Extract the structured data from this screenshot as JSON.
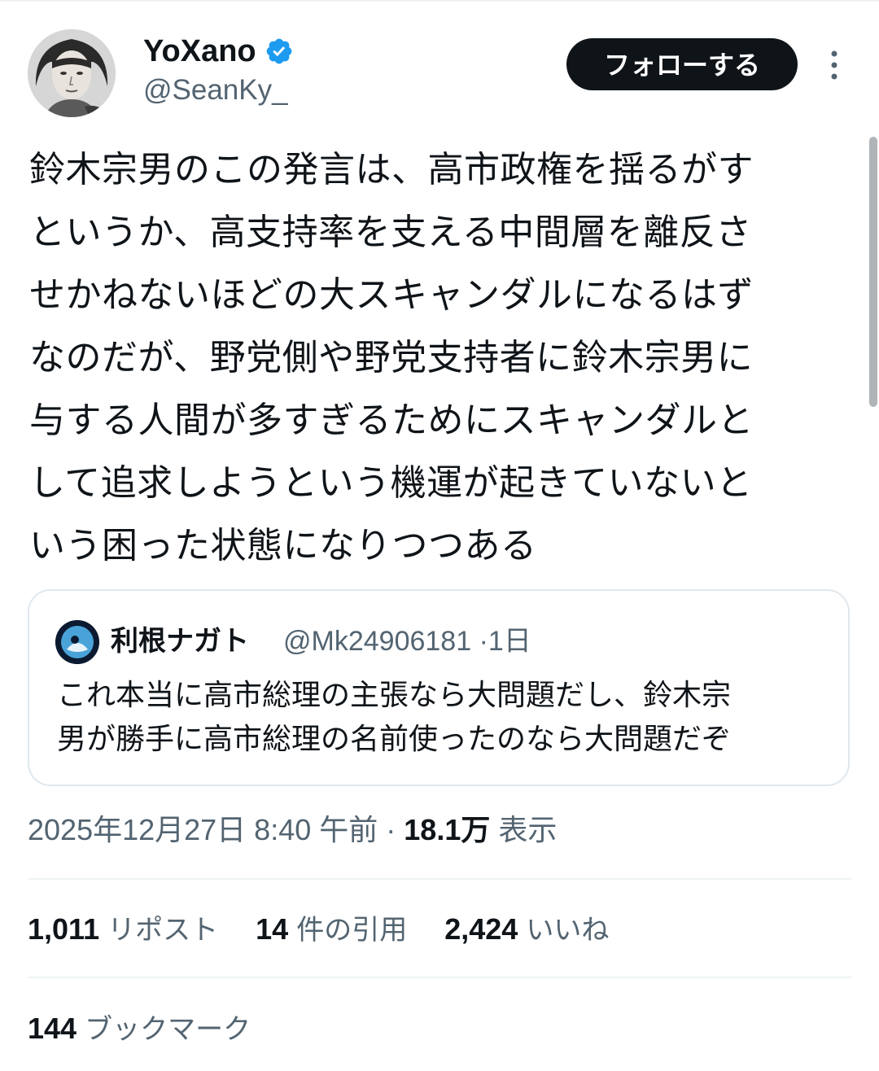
{
  "author": {
    "display_name": "YoXano",
    "handle": "@SeanKy_",
    "verified": true,
    "avatar_icon": "portrait-avatar"
  },
  "follow_button": {
    "label": "フォローする"
  },
  "more_icon": "more-vertical-icon",
  "tweet": {
    "lines": [
      "鈴木宗男のこの発言は、高市政権を揺るがす",
      "というか、高支持率を支える中間層を離反さ",
      "せかねないほどの大スキャンダルになるはず",
      "なのだが、野党側や野党支持者に鈴木宗男に",
      "与する人間が多すぎるためにスキャンダルと",
      "して追求しようという機運が起きていないと",
      "いう困った状態になりつつある"
    ]
  },
  "quote": {
    "display_name": "利根ナガト",
    "handle": "@Mk24906181",
    "separator": "·",
    "time": "1日",
    "lines": [
      "これ本当に高市総理の主張なら大問題だし、鈴木宗",
      "男が勝手に高市総理の名前使ったのなら大問題だぞ"
    ]
  },
  "meta": {
    "timestamp": "2025年12月27日 8:40 午前",
    "separator": "·",
    "views_count": "18.1万",
    "views_label": "表示"
  },
  "stats": {
    "reposts_count": "1,011",
    "reposts_label": "リポスト",
    "quotes_count": "14",
    "quotes_label": "件の引用",
    "likes_count": "2,424",
    "likes_label": "いいね",
    "bookmarks_count": "144",
    "bookmarks_label": "ブックマーク"
  },
  "colors": {
    "text": "#0f1419",
    "secondary": "#536471",
    "verified": "#1d9bf0",
    "border": "#e1e8ed"
  }
}
